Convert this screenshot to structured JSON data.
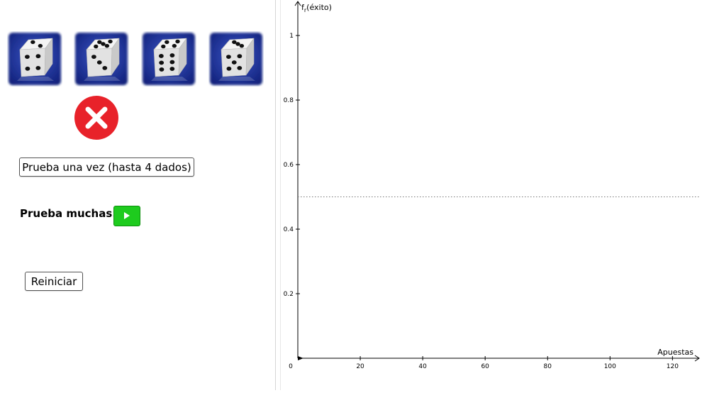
{
  "dice": [
    {
      "name": "die-1",
      "top_face": 2,
      "front_face": 4
    },
    {
      "name": "die-2",
      "top_face": 5,
      "front_face": 3
    },
    {
      "name": "die-3",
      "top_face": 4,
      "front_face": 6
    },
    {
      "name": "die-4",
      "top_face": 3,
      "front_face": 5
    }
  ],
  "result": {
    "icon": "x-circle-icon",
    "color": "#e8222a"
  },
  "controls": {
    "try_once_label": "Prueba una vez (hasta 4 dados)",
    "try_many_label": "Prueba muchas:",
    "play_icon": "play-icon",
    "play_color": "#1ecb1e",
    "reset_label": "Reiniciar"
  },
  "chart_data": {
    "type": "line",
    "ylabel_main": "f",
    "ylabel_sub": "r",
    "ylabel_rest": "(éxito)",
    "xlabel": "Apuestas",
    "x_ticks": [
      20,
      40,
      60,
      80,
      100,
      120
    ],
    "y_ticks": [
      "0.2",
      "0.4",
      "0.6",
      "0.8",
      "1"
    ],
    "origin_label": "0",
    "xlim": [
      0,
      129
    ],
    "ylim": [
      0,
      1.11
    ],
    "series": [],
    "reference_line": {
      "y": 0.5,
      "style": "dotted"
    },
    "grid": false
  }
}
